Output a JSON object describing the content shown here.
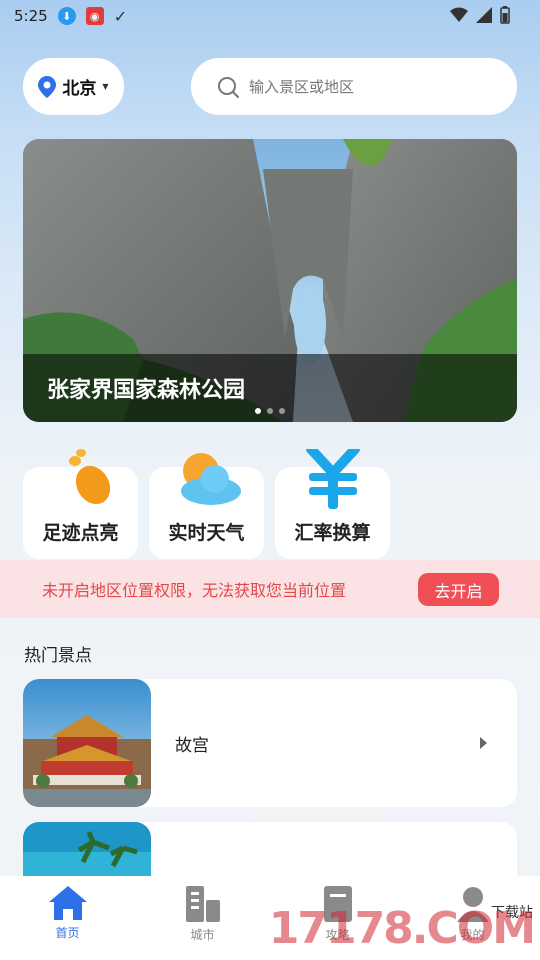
{
  "status": {
    "time": "5:25"
  },
  "header": {
    "city": "北京",
    "search_placeholder": "输入景区或地区"
  },
  "banner": {
    "caption": "张家界国家森林公园",
    "page_count": 3,
    "active_page": 1
  },
  "features": [
    {
      "label": "足迹点亮",
      "icon": "footprint-icon"
    },
    {
      "label": "实时天气",
      "icon": "weather-icon"
    },
    {
      "label": "汇率换算",
      "icon": "yen-icon"
    }
  ],
  "permission": {
    "message": "未开启地区位置权限，无法获取您当前位置",
    "button": "去开启"
  },
  "hot_spots": {
    "title": "热门景点",
    "items": [
      {
        "name": "故宫"
      },
      {
        "name": ""
      }
    ]
  },
  "nav": {
    "items": [
      {
        "label": "首页",
        "icon": "home-icon",
        "active": true
      },
      {
        "label": "城市",
        "icon": "building-icon",
        "active": false
      },
      {
        "label": "攻略",
        "icon": "guide-icon",
        "active": false
      },
      {
        "label": "我的",
        "icon": "profile-icon",
        "active": false
      }
    ]
  },
  "watermark": {
    "text": "17178.COM",
    "small": "下载站"
  },
  "colors": {
    "accent": "#2e70e8",
    "warning_bg": "#fbe2e4",
    "warning_text": "#e24a4a",
    "warning_button": "#ef4f55"
  }
}
